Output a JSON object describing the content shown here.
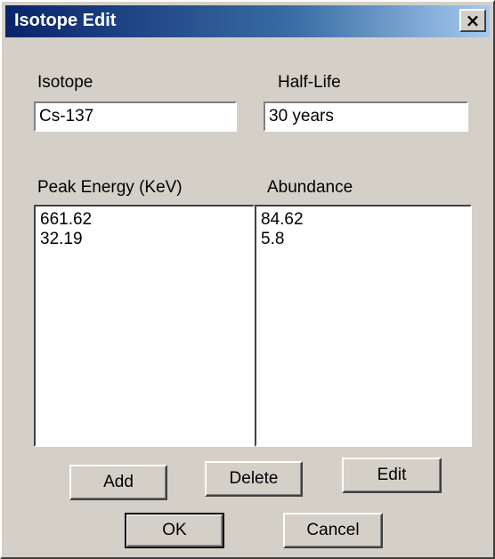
{
  "window": {
    "title": "Isotope Edit",
    "close_label": "×"
  },
  "fields": {
    "isotope": {
      "label": "Isotope",
      "value": "Cs-137"
    },
    "half_life": {
      "label": "Half-Life",
      "value": "30 years"
    }
  },
  "lists": {
    "peak_energy": {
      "label": "Peak Energy (KeV)",
      "items": [
        "661.62",
        "32.19"
      ]
    },
    "abundance": {
      "label": "Abundance",
      "items": [
        "84.62",
        "5.8"
      ]
    }
  },
  "buttons": {
    "add": "Add",
    "delete": "Delete",
    "edit": "Edit",
    "ok": "OK",
    "cancel": "Cancel"
  }
}
